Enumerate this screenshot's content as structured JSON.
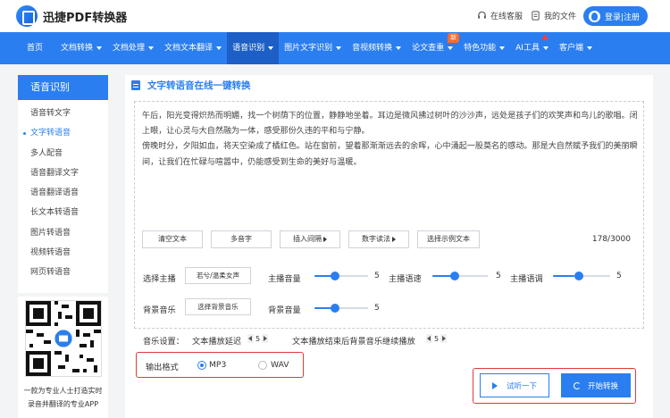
{
  "header": {
    "logo_text": "迅捷PDF转换器",
    "service_label": "在线客服",
    "files_label": "我的文件",
    "login_label": "登录|注册"
  },
  "nav": {
    "items": [
      {
        "label": "首页",
        "caret": false
      },
      {
        "label": "文档转换",
        "caret": true
      },
      {
        "label": "文档处理",
        "caret": true
      },
      {
        "label": "文档文本翻译",
        "caret": true
      },
      {
        "label": "语音识别",
        "caret": true,
        "active": true
      },
      {
        "label": "图片文字识别",
        "caret": true
      },
      {
        "label": "音视频转换",
        "caret": true
      },
      {
        "label": "论文查重",
        "caret": true,
        "badge": "新"
      },
      {
        "label": "特色功能",
        "caret": true
      },
      {
        "label": "AI工具",
        "caret": true
      },
      {
        "label": "客户端",
        "caret": true
      }
    ]
  },
  "sidebar": {
    "title": "语音识别",
    "items": [
      {
        "label": "语音转文字"
      },
      {
        "label": "文字转语音",
        "active": true
      },
      {
        "label": "多人配音"
      },
      {
        "label": "语音翻译文字"
      },
      {
        "label": "语音翻译语音"
      },
      {
        "label": "长文本转语音"
      },
      {
        "label": "图片转语音"
      },
      {
        "label": "视频转语音"
      },
      {
        "label": "网页转语音"
      }
    ]
  },
  "qr": {
    "caption_1": "一款为专业人士打造实时",
    "caption_2": "录音并翻译的专业APP"
  },
  "main": {
    "title": "文字转语音在线一键转换",
    "text_1": "午后，阳光变得炽热而明媚，找一个树荫下的位置，静静地坐着。耳边是微风拂过树叶的沙沙声，远处是孩子们的欢笑声和鸟儿的歌唱。闭上眼，让心灵与大自然融为一体，感受那份久违的平和与宁静。",
    "text_2": "傍晚时分，夕阳如血，将天空染成了橘红色。站在窗前，望着那渐渐远去的余晖，心中涌起一股莫名的感动。那是大自然赋予我们的美丽瞬间，让我们在忙碌与喧嚣中，仍能感受到生命的美好与温暖。",
    "tools": {
      "clear": "清空文本",
      "polyphone": "多音字",
      "insert_pause": "插入间隔",
      "number_read": "数字读法",
      "sample": "选择示例文本"
    },
    "char_count": "178/3000"
  },
  "settings": {
    "anchor_label": "选择主播",
    "anchor_value": "若兮/温柔女声",
    "volume_label": "主播音量",
    "volume_value": "5",
    "speed_label": "主播语速",
    "speed_value": "5",
    "pitch_label": "主播语调",
    "pitch_value": "5",
    "bgm_label": "背景音乐",
    "bgm_button": "选择背景音乐",
    "bgm_volume_label": "背景音量",
    "bgm_volume_value": "5",
    "music_settings_label": "音乐设置：",
    "delay_label": "文本播放延迟",
    "delay_value": "5",
    "continue_label": "文本播放结束后背景音乐继续播放",
    "continue_value": "5",
    "format_label": "输出格式",
    "format_mp3": "MP3",
    "format_wav": "WAV",
    "format_selected": "MP3"
  },
  "actions": {
    "listen_label": "试听一下",
    "convert_label": "开始转换"
  },
  "colors": {
    "accent": "#2a7ef0",
    "highlight_border": "#e23b3b",
    "badge": "#ff6a2b"
  }
}
